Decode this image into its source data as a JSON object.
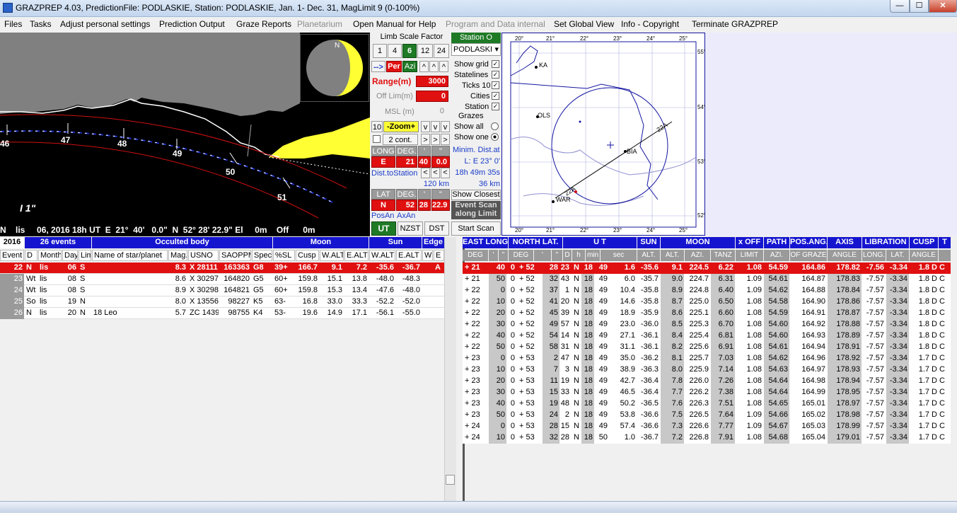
{
  "window": {
    "title": "GRAZPREP 4.03, PredictionFile: PODLASKIE, Station: PODLASKIE, Jan. 1- Dec. 31, MagLimit 9 (0-100%)",
    "min": "—",
    "max": "☐",
    "close": "✕"
  },
  "menu": [
    "Files",
    "Tasks",
    "Adjust personal settings",
    "Prediction Output",
    "Graze Reports",
    "Planetarium",
    "Open Manual for Help",
    "Program and Data internal",
    "Set Global View",
    "Info - Copyright",
    "Terminate GRAZPREP"
  ],
  "profile": {
    "ticks": [
      "46",
      "47",
      "48",
      "49",
      "50",
      "51"
    ],
    "scale_label": "1\"",
    "status": "N    lis     06, 2016 18h UT  E  21°  40'   0.0\"  N  52° 28' 22.9\" El     0m    Off      0m",
    "moon_n": "N"
  },
  "controls": {
    "limb_scale_label": "Limb Scale Factor",
    "scale_buttons": [
      "1",
      "4",
      "6",
      "12",
      "24"
    ],
    "arrow": "-->",
    "per": "Per",
    "azi": "Azi",
    "ud": [
      "^",
      "^",
      "^"
    ],
    "range_label": "Range(m)",
    "range_value": "3000",
    "offlim_label": "Off Lim(m)",
    "offlim_value": "0",
    "msl_label": "MSL (m)",
    "msl_value": "0",
    "zoom_num": "10",
    "zoom_label": "-Zoom+",
    "vvv": [
      "v",
      "v",
      "v"
    ],
    "cont_label": "2 cont.",
    "nav": [
      ">",
      ">",
      ">"
    ],
    "long_label": "LONG",
    "deg_label": "DEG.",
    "min_mark": "'",
    "sec_mark": "\"",
    "long_dir": "E",
    "long_deg": "21",
    "long_min": "40",
    "long_sec": "0.0",
    "dist_label": "Dist.toStation",
    "lt": [
      "<",
      "<",
      "<"
    ],
    "dist_value": "120 km",
    "lat_label": "LAT",
    "lat_dir": "N",
    "lat_deg": "52",
    "lat_min": "28",
    "lat_sec": "22.9",
    "posan": "PosAn",
    "axan": "AxAn",
    "ut": "UT",
    "nzst": "NZST",
    "dst": "DST"
  },
  "station": {
    "header": "Station O",
    "name": "PODLASKI",
    "show_grid": "Show grid",
    "statelines": "Statelines",
    "ticks10": "Ticks 10",
    "cities": "Cities",
    "station": "Station",
    "grazes": "Grazes",
    "show_all": "Show all",
    "show_one": "Show one",
    "minim_dist": "Minim. Dist.at",
    "minim_l": "L:  E 23° 0'",
    "minim_time": "18h 49m 35s",
    "minim_km": "36 km",
    "show_closest": "Show Closest",
    "event_scan": "Event Scan along Limit",
    "start_scan": "Start Scan",
    "check": "✓"
  },
  "map": {
    "top_ticks": [
      "20°",
      "21°",
      "22°",
      "23°",
      "24°",
      "25°"
    ],
    "bottom_ticks": [
      "20°",
      "21°",
      "22°",
      "23°",
      "24°",
      "25°"
    ],
    "right_ticks": [
      "55°",
      "54°",
      "53°",
      "52°"
    ],
    "cities": [
      "KA",
      "OLS",
      "BIA",
      "WAR"
    ],
    "path_labels": [
      "22A",
      "22A"
    ]
  },
  "left_table": {
    "year": "2016",
    "events": "26  events",
    "occulted": "Occulted body",
    "moon": "Moon",
    "sun": "Sun",
    "edge": "Edge",
    "cols": [
      "Event",
      "D",
      "Month",
      "Day",
      "Lim",
      "Name of star/planet",
      "Mag.",
      "USNO",
      "SAOPPM",
      "Spec",
      "%SL",
      "Cusp",
      "W.ALT",
      "E.ALT",
      "W.ALT",
      "E.ALT",
      "W",
      "E"
    ],
    "rows": [
      [
        "22",
        "N",
        "lis",
        "06",
        "S",
        "",
        "8.3",
        "X 28111",
        "163363",
        "G8",
        "39+",
        "166.7",
        "9.1",
        "7.2",
        "-35.6",
        "-36.7",
        "",
        "A"
      ],
      [
        "23",
        "Wt",
        "lis",
        "08",
        "S",
        "",
        "8.6",
        "X 30297",
        "164820",
        "G5",
        "60+",
        "159.8",
        "15.1",
        "13.8",
        "-48.0",
        "-48.3",
        "",
        ""
      ],
      [
        "24",
        "Wt",
        "lis",
        "08",
        "S",
        "",
        "8.9",
        "X 30298",
        "164821",
        "G5",
        "60+",
        "159.8",
        "15.3",
        "13.4",
        "-47.6",
        "-48.0",
        "",
        ""
      ],
      [
        "25",
        "So",
        "lis",
        "19",
        "N",
        "",
        "8.0",
        "X 13556",
        "98227",
        "K5",
        "63-",
        "16.8",
        "33.0",
        "33.3",
        "-52.2",
        "-52.0",
        "",
        ""
      ],
      [
        "26",
        "N",
        "lis",
        "20",
        "N",
        "18 Leo",
        "5.7",
        "ZC 1439",
        "98755",
        "K4",
        "53-",
        "19.6",
        "14.9",
        "17.1",
        "-56.1",
        "-55.0",
        "",
        ""
      ]
    ]
  },
  "right_table": {
    "groups": [
      "EAST LONG",
      "NORTH LAT.",
      "U T",
      "SUN",
      "MOON",
      "x OFF",
      "PATH",
      "POS.ANG.",
      "AXIS",
      "LIBRATION",
      "CUSP",
      "T"
    ],
    "sub": [
      "DEG",
      "'",
      "\"",
      "DEG",
      "'",
      "\"",
      "D",
      "h",
      "min",
      "sec",
      "ALT.",
      "ALT.",
      "AZI.",
      "TANZ",
      "LIMIT",
      "AZI.",
      "OF GRAZE",
      "ANGLE",
      "LONG.",
      "LAT.",
      "ANGLE",
      ""
    ],
    "rows": [
      [
        "+  21",
        "40",
        "0",
        "+  52",
        "28",
        "23",
        "N",
        "18",
        "49",
        "1.6",
        "-35.6",
        "9.1",
        "224.5",
        "6.22",
        "1.08",
        "54.59",
        "164.86",
        "178.82",
        "-7.56",
        "-3.34",
        "1.8",
        "D",
        "C"
      ],
      [
        "+  21",
        "50",
        "0",
        "+  52",
        "32",
        "43",
        "N",
        "18",
        "49",
        "6.0",
        "-35.7",
        "9.0",
        "224.7",
        "6.31",
        "1.09",
        "54.61",
        "164.87",
        "178.83",
        "-7.57",
        "-3.34",
        "1.8",
        "D",
        "C"
      ],
      [
        "+  22",
        "0",
        "0",
        "+  52",
        "37",
        "1",
        "N",
        "18",
        "49",
        "10.4",
        "-35.8",
        "8.9",
        "224.8",
        "6.40",
        "1.09",
        "54.62",
        "164.88",
        "178.84",
        "-7.57",
        "-3.34",
        "1.8",
        "D",
        "C"
      ],
      [
        "+  22",
        "10",
        "0",
        "+  52",
        "41",
        "20",
        "N",
        "18",
        "49",
        "14.6",
        "-35.8",
        "8.7",
        "225.0",
        "6.50",
        "1.08",
        "54.58",
        "164.90",
        "178.86",
        "-7.57",
        "-3.34",
        "1.8",
        "D",
        "C"
      ],
      [
        "+  22",
        "20",
        "0",
        "+  52",
        "45",
        "39",
        "N",
        "18",
        "49",
        "18.9",
        "-35.9",
        "8.6",
        "225.1",
        "6.60",
        "1.08",
        "54.59",
        "164.91",
        "178.87",
        "-7.57",
        "-3.34",
        "1.8",
        "D",
        "C"
      ],
      [
        "+  22",
        "30",
        "0",
        "+  52",
        "49",
        "57",
        "N",
        "18",
        "49",
        "23.0",
        "-36.0",
        "8.5",
        "225.3",
        "6.70",
        "1.08",
        "54.60",
        "164.92",
        "178.88",
        "-7.57",
        "-3.34",
        "1.8",
        "D",
        "C"
      ],
      [
        "+  22",
        "40",
        "0",
        "+  52",
        "54",
        "14",
        "N",
        "18",
        "49",
        "27.1",
        "-36.1",
        "8.4",
        "225.4",
        "6.81",
        "1.08",
        "54.60",
        "164.93",
        "178.89",
        "-7.57",
        "-3.34",
        "1.8",
        "D",
        "C"
      ],
      [
        "+  22",
        "50",
        "0",
        "+  52",
        "58",
        "31",
        "N",
        "18",
        "49",
        "31.1",
        "-36.1",
        "8.2",
        "225.6",
        "6.91",
        "1.08",
        "54.61",
        "164.94",
        "178.91",
        "-7.57",
        "-3.34",
        "1.8",
        "D",
        "C"
      ],
      [
        "+  23",
        "0",
        "0",
        "+  53",
        "2",
        "47",
        "N",
        "18",
        "49",
        "35.0",
        "-36.2",
        "8.1",
        "225.7",
        "7.03",
        "1.08",
        "54.62",
        "164.96",
        "178.92",
        "-7.57",
        "-3.34",
        "1.7",
        "D",
        "C"
      ],
      [
        "+  23",
        "10",
        "0",
        "+  53",
        "7",
        "3",
        "N",
        "18",
        "49",
        "38.9",
        "-36.3",
        "8.0",
        "225.9",
        "7.14",
        "1.08",
        "54.63",
        "164.97",
        "178.93",
        "-7.57",
        "-3.34",
        "1.7",
        "D",
        "C"
      ],
      [
        "+  23",
        "20",
        "0",
        "+  53",
        "11",
        "19",
        "N",
        "18",
        "49",
        "42.7",
        "-36.4",
        "7.8",
        "226.0",
        "7.26",
        "1.08",
        "54.64",
        "164.98",
        "178.94",
        "-7.57",
        "-3.34",
        "1.7",
        "D",
        "C"
      ],
      [
        "+  23",
        "30",
        "0",
        "+  53",
        "15",
        "33",
        "N",
        "18",
        "49",
        "46.5",
        "-36.4",
        "7.7",
        "226.2",
        "7.38",
        "1.08",
        "54.64",
        "164.99",
        "178.95",
        "-7.57",
        "-3.34",
        "1.7",
        "D",
        "C"
      ],
      [
        "+  23",
        "40",
        "0",
        "+  53",
        "19",
        "48",
        "N",
        "18",
        "49",
        "50.2",
        "-36.5",
        "7.6",
        "226.3",
        "7.51",
        "1.08",
        "54.65",
        "165.01",
        "178.97",
        "-7.57",
        "-3.34",
        "1.7",
        "D",
        "C"
      ],
      [
        "+  23",
        "50",
        "0",
        "+  53",
        "24",
        "2",
        "N",
        "18",
        "49",
        "53.8",
        "-36.6",
        "7.5",
        "226.5",
        "7.64",
        "1.09",
        "54.66",
        "165.02",
        "178.98",
        "-7.57",
        "-3.34",
        "1.7",
        "D",
        "C"
      ],
      [
        "+  24",
        "0",
        "0",
        "+  53",
        "28",
        "15",
        "N",
        "18",
        "49",
        "57.4",
        "-36.6",
        "7.3",
        "226.6",
        "7.77",
        "1.09",
        "54.67",
        "165.03",
        "178.99",
        "-7.57",
        "-3.34",
        "1.7",
        "D",
        "C"
      ],
      [
        "+  24",
        "10",
        "0",
        "+  53",
        "32",
        "28",
        "N",
        "18",
        "50",
        "1.0",
        "-36.7",
        "7.2",
        "226.8",
        "7.91",
        "1.08",
        "54.68",
        "165.04",
        "179.01",
        "-7.57",
        "-3.34",
        "1.7",
        "D",
        "C"
      ]
    ]
  },
  "colors": {
    "blue": "#1515d0",
    "red": "#e01010",
    "green": "#1f7a26",
    "grey": "#9a9a9a",
    "yellow": "#ffff33"
  }
}
